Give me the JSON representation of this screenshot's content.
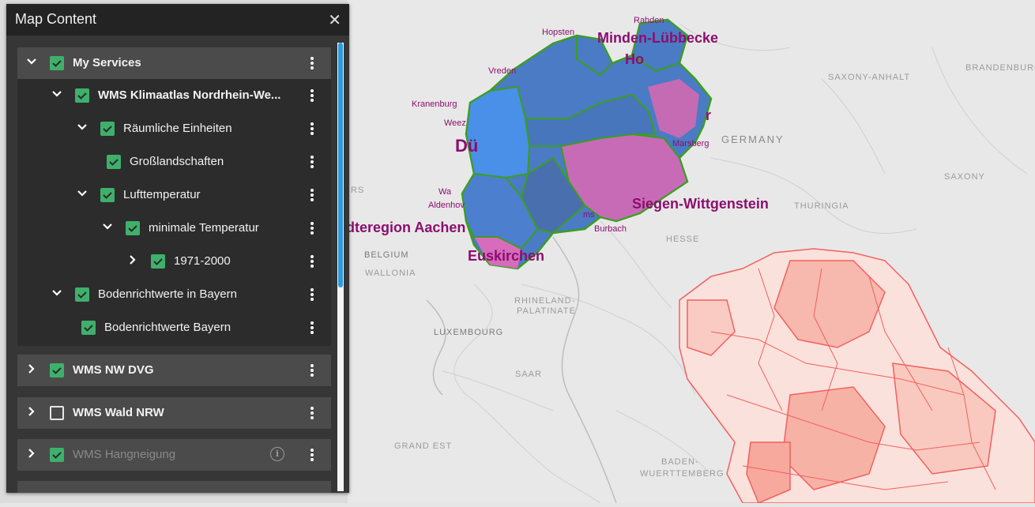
{
  "panel": {
    "title": "Map Content",
    "close_icon": "close-icon"
  },
  "tree": {
    "my_services": "My Services",
    "wms_klimaatlas": "WMS Klimaatlas Nordrhein-We...",
    "raeumliche": "Räumliche Einheiten",
    "grosslandschaften": "Großlandschaften",
    "lufttemperatur": "Lufttemperatur",
    "minimale_temperatur": "minimale Temperatur",
    "period": "1971-2000",
    "bodenrichtwerte_bayern_group": "Bodenrichtwerte in Bayern",
    "bodenrichtwerte_bayern": "Bodenrichtwerte Bayern"
  },
  "groups": {
    "wms_nw_dvg": "WMS NW DVG",
    "wms_wald_nrw": "WMS Wald NRW",
    "wms_hangneigung": "WMS Hangneigung"
  },
  "map": {
    "labels": {
      "saxony_anhalt": "SAXONY-ANHALT",
      "brandenburg": "BRANDENBURG",
      "germany": "GERMANY",
      "saxony": "SAXONY",
      "thuringia": "THURINGIA",
      "hesse": "HESSE",
      "belgium": "BELGIUM",
      "wallonia": "WALLONIA",
      "rhineland_1": "RHINELAND-",
      "rhineland_2": "PALATINATE",
      "luxembourg": "LUXEMBOURG",
      "saar": "SAAR",
      "grand_est": "GRAND EST",
      "baden_1": "BADEN-",
      "baden_2": "WUERTTEMBERG",
      "rs": "RS",
      "hopsten": "Hopsten",
      "rahden": "Rahden",
      "minden": "Minden-Lübbecke",
      "ho": "Ho",
      "vreden": "Vreden",
      "kranenburg": "Kranenburg",
      "weeze": "Weez",
      "due": "Dü",
      "r": "r",
      "marsberg": "Marsberg",
      "wa": "Wa",
      "aldenhoven": "Aldenhov",
      "siegen": "Siegen-Wittgenstein",
      "aachen": "dteregion Aachen",
      "burbach": "Burbach",
      "euskirchen": "Euskirchen",
      "ms": "ms"
    }
  },
  "colors": {
    "checkbox_on": "#3fb06c",
    "scroll_thumb": "#2f9bd9",
    "nrw_blue_dark": "#4a78c0",
    "nrw_blue_light": "#4a8ee6",
    "nrw_pink": "#d65fb5",
    "nrw_border": "#3b9e1f",
    "bayern_red": "#f36060"
  }
}
